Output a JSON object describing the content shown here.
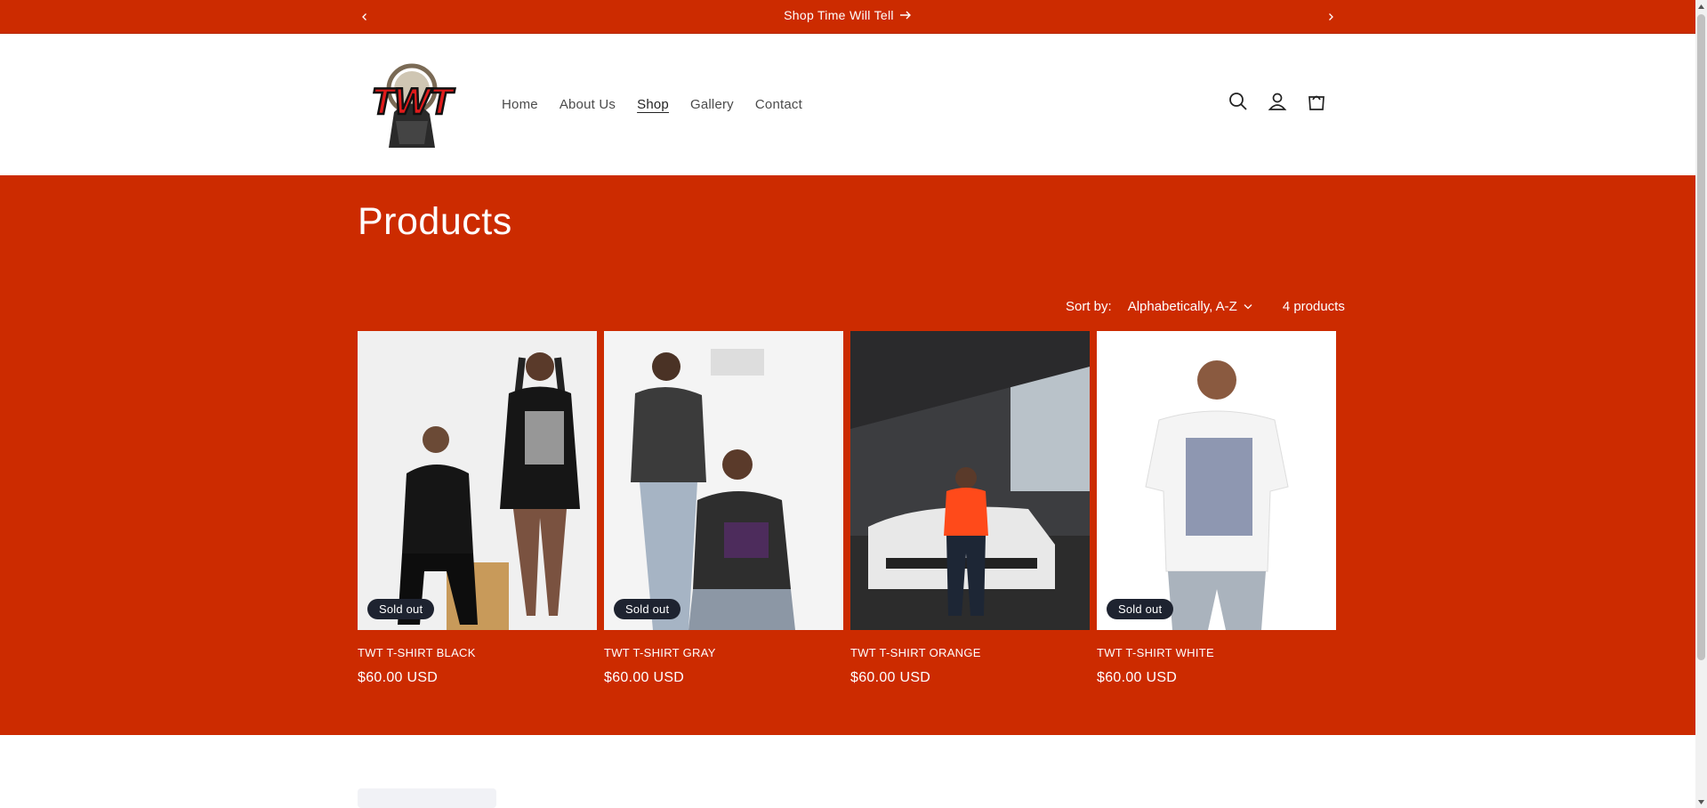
{
  "announcement": {
    "text": "Shop Time Will Tell",
    "prev_icon": "chevron-left-icon",
    "next_icon": "chevron-right-icon",
    "arrow_icon": "arrow-right-icon"
  },
  "brand": {
    "logo_text": "TWT"
  },
  "nav": {
    "items": [
      {
        "label": "Home"
      },
      {
        "label": "About Us"
      },
      {
        "label": "Shop",
        "active": true
      },
      {
        "label": "Gallery"
      },
      {
        "label": "Contact"
      }
    ]
  },
  "header_icons": [
    "search-icon",
    "account-icon",
    "cart-icon"
  ],
  "collection": {
    "title": "Products",
    "sort_label": "Sort by:",
    "sort_value": "Alphabetically, A-Z",
    "count": "4 products",
    "products": [
      {
        "name": "TWT T-SHIRT BLACK",
        "price": "$60.00 USD",
        "badge": "Sold out"
      },
      {
        "name": "TWT T-SHIRT GRAY",
        "price": "$60.00 USD",
        "badge": "Sold out"
      },
      {
        "name": "TWT T-SHIRT ORANGE",
        "price": "$60.00 USD",
        "badge": ""
      },
      {
        "name": "TWT T-SHIRT WHITE",
        "price": "$60.00 USD",
        "badge": "Sold out"
      }
    ]
  },
  "colors": {
    "brand_red": "#cc2b00",
    "badge_bg": "#1e2330",
    "white": "#ffffff"
  }
}
